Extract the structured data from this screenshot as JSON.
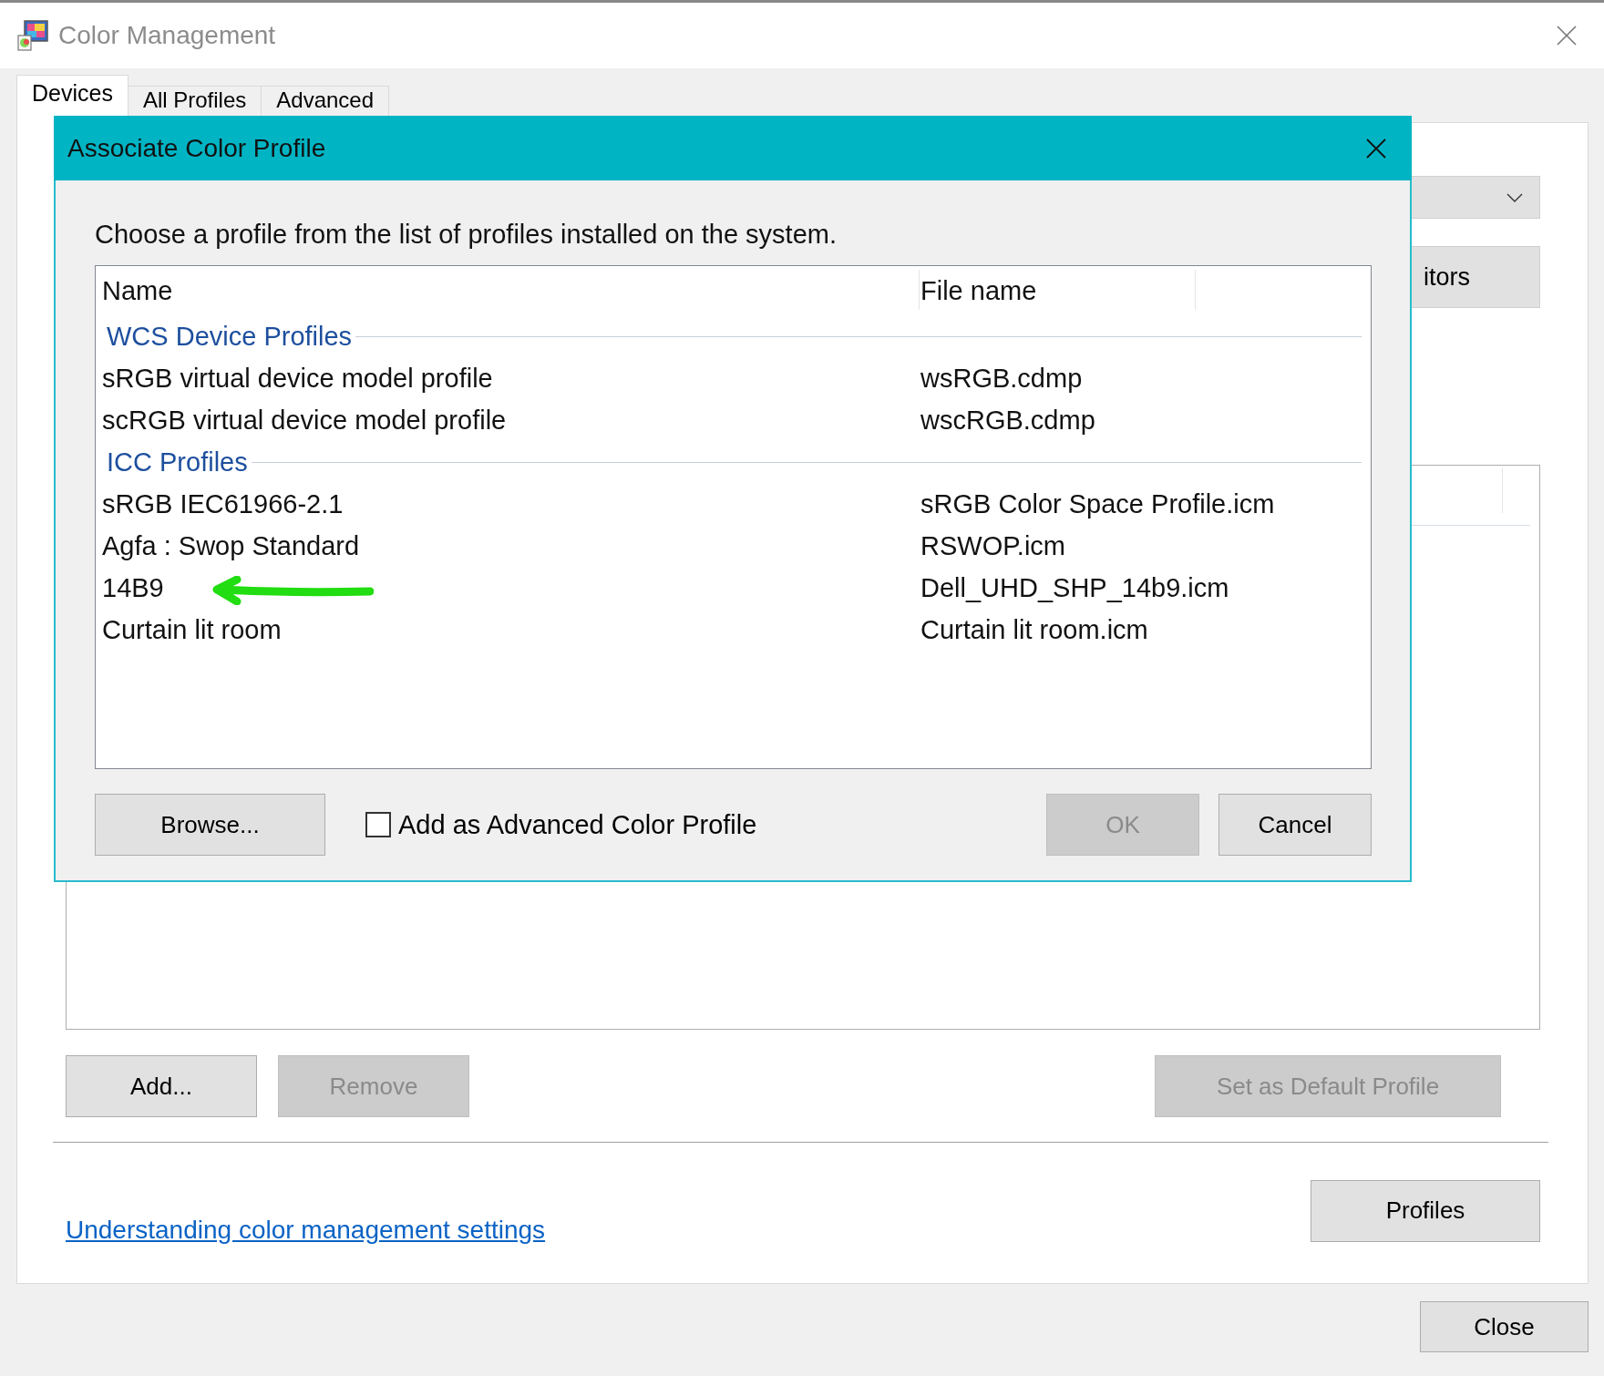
{
  "window": {
    "title": "Color Management"
  },
  "tabs": [
    {
      "label": "Devices",
      "selected": true
    },
    {
      "label": "All Profiles",
      "selected": false
    },
    {
      "label": "Advanced",
      "selected": false
    }
  ],
  "device_button": {
    "label": "itors"
  },
  "profile_buttons": [
    {
      "label": "Add...",
      "disabled": false
    },
    {
      "label": "Remove",
      "disabled": true
    },
    {
      "label": "Set as Default Profile",
      "disabled": true
    }
  ],
  "help_link": "Understanding color management settings",
  "profiles_button": {
    "label": "Profiles"
  },
  "close_button": {
    "label": "Close"
  },
  "dialog": {
    "title": "Associate Color Profile",
    "prompt": "Choose a profile from the list of profiles installed on the system.",
    "columns": [
      "Name",
      "File name"
    ],
    "groups": [
      {
        "title": "WCS Device Profiles",
        "rows": [
          {
            "name": "sRGB virtual device model profile",
            "file": "wsRGB.cdmp"
          },
          {
            "name": "scRGB virtual device model profile",
            "file": "wscRGB.cdmp"
          }
        ]
      },
      {
        "title": "ICC Profiles",
        "rows": [
          {
            "name": "sRGB IEC61966-2.1",
            "file": "sRGB Color Space Profile.icm"
          },
          {
            "name": "Agfa : Swop Standard",
            "file": "RSWOP.icm"
          },
          {
            "name": "14B9",
            "file": "Dell_UHD_SHP_14b9.icm"
          },
          {
            "name": "Curtain lit room",
            "file": "Curtain lit room.icm"
          }
        ]
      }
    ],
    "browse_button": {
      "label": "Browse..."
    },
    "advanced_checkbox": {
      "label": "Add as Advanced Color Profile",
      "checked": false
    },
    "action_buttons": [
      {
        "label": "OK",
        "disabled": true
      },
      {
        "label": "Cancel",
        "disabled": false
      }
    ]
  }
}
